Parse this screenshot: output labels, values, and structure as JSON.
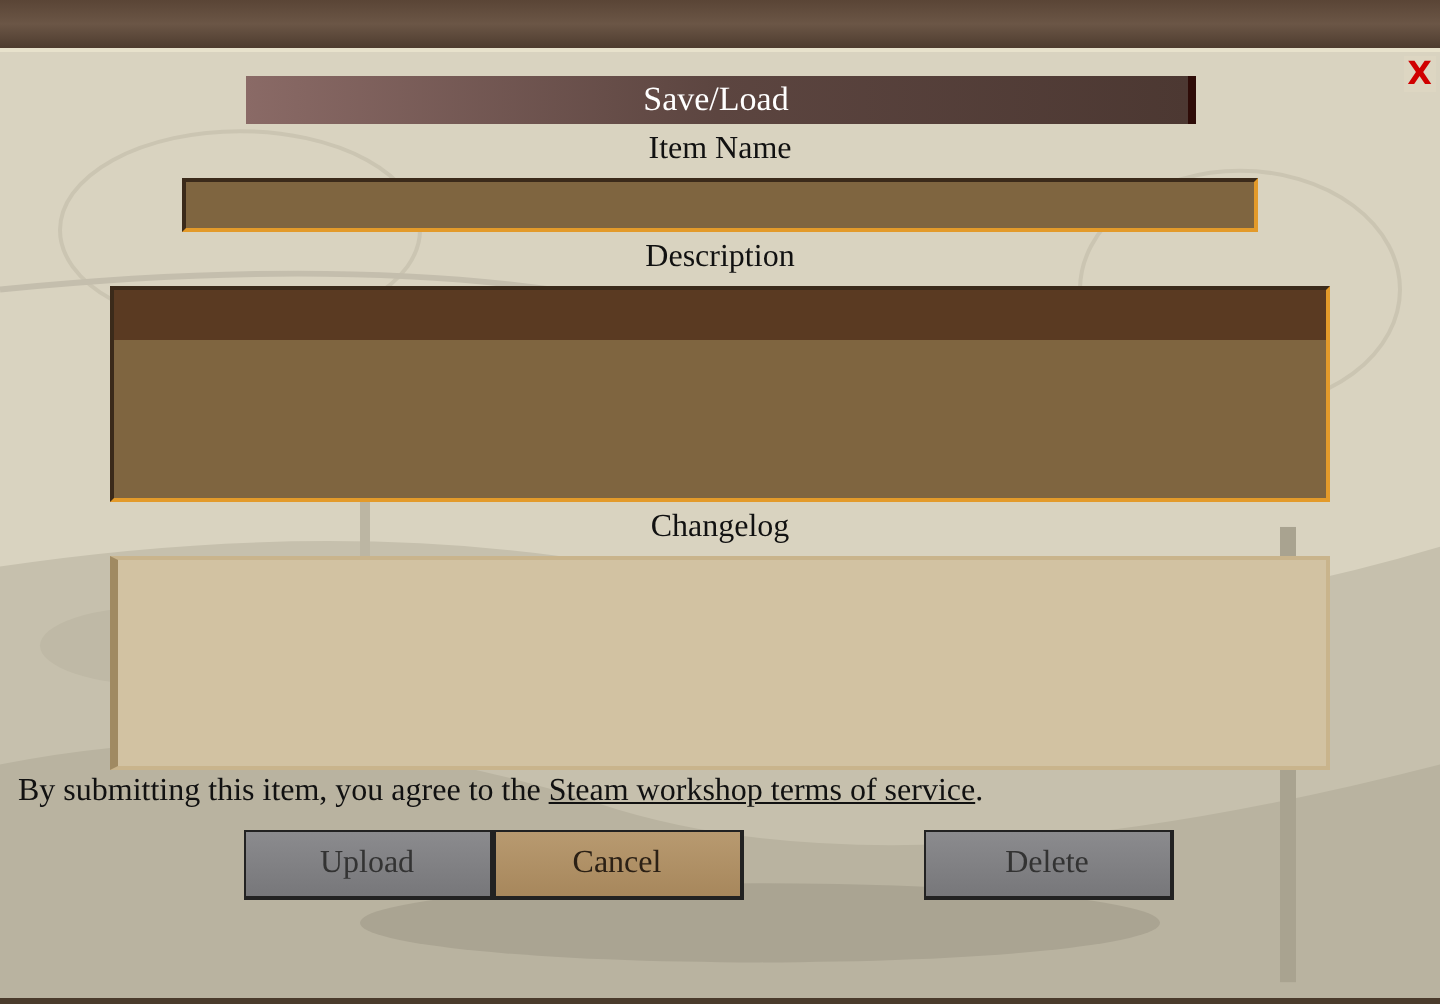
{
  "window": {
    "close_glyph": "X"
  },
  "dialog_title": "Save/Load",
  "fields": [
    {
      "label": "Item Name",
      "kind": "line"
    },
    {
      "label": "Description",
      "kind": "area-highlight"
    },
    {
      "label": "Changelog",
      "kind": "parchment"
    }
  ],
  "agreement": {
    "text": "By submitting this item, you agree to the ",
    "link": "Steam workshop terms of service",
    "end": "."
  },
  "buttons": [
    {
      "label": "Upload",
      "highlighted": false,
      "gap_before": false
    },
    {
      "label": "Cancel",
      "highlighted": true,
      "gap_before": false
    },
    {
      "label": "Delete",
      "highlighted": false,
      "gap_before": true
    }
  ]
}
